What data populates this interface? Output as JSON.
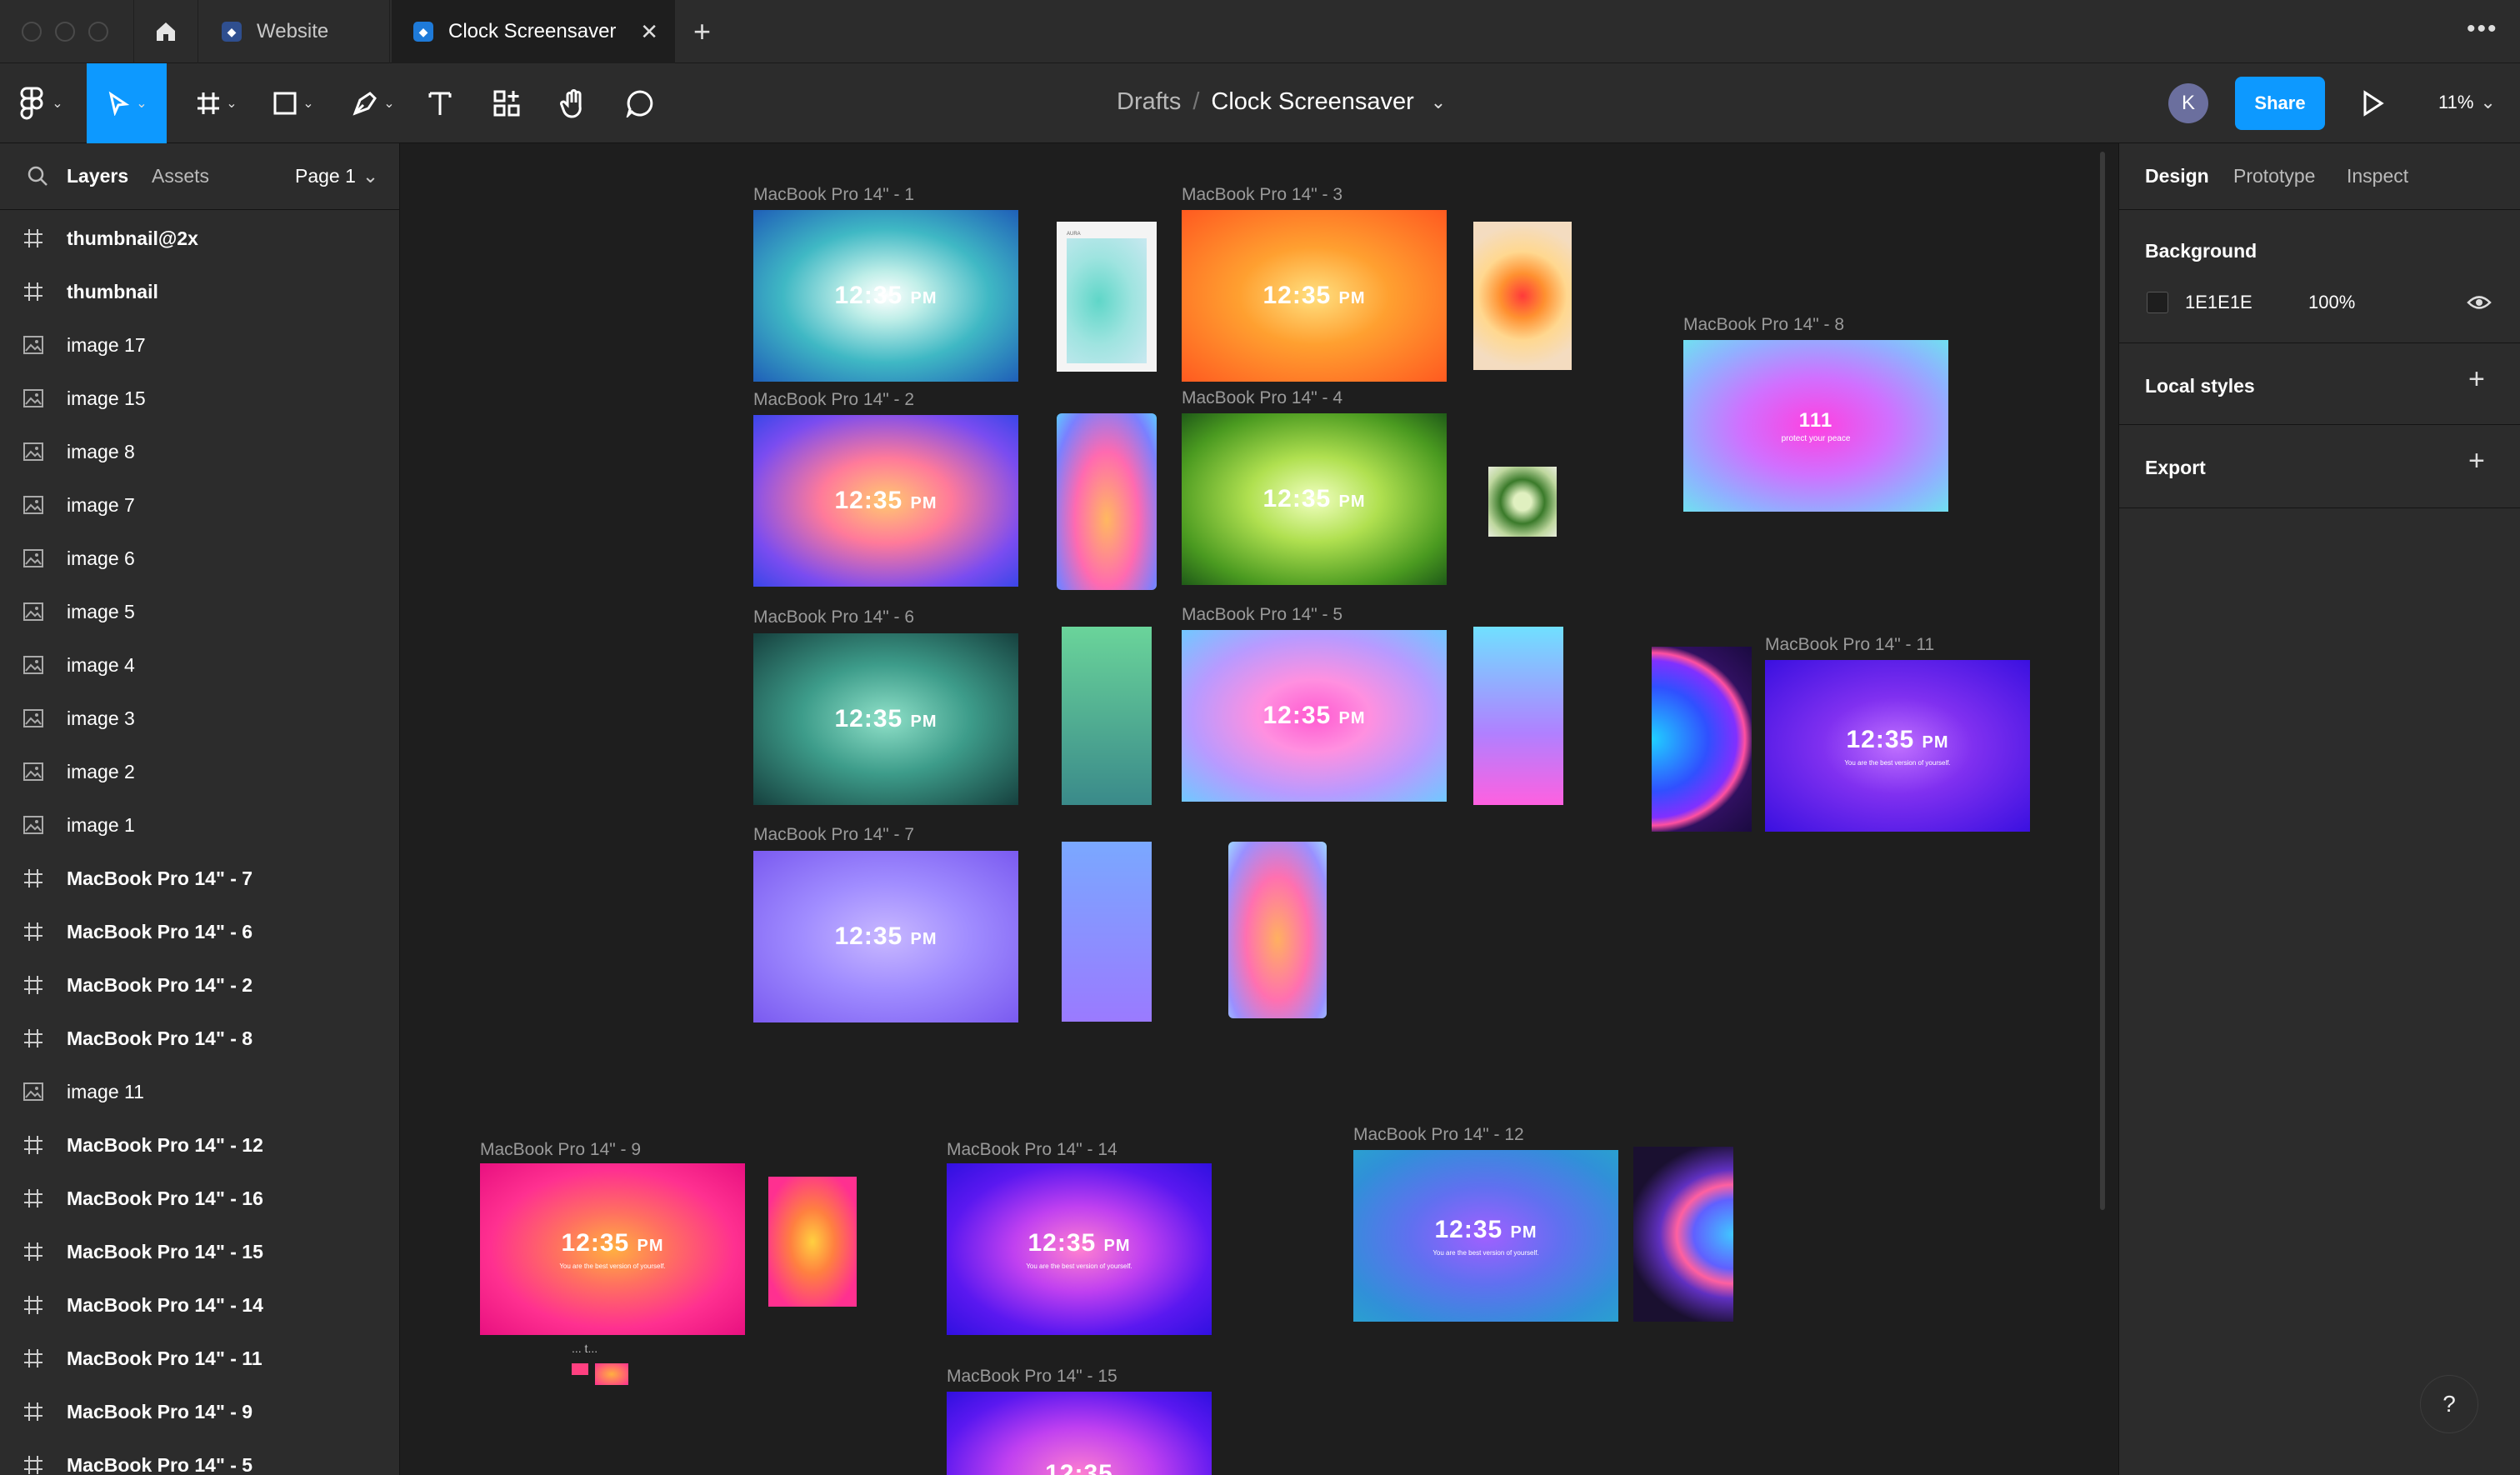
{
  "tabs": {
    "website": "Website",
    "active": "Clock Screensaver"
  },
  "header": {
    "breadcrumb_parent": "Drafts",
    "breadcrumb_sep": "/",
    "file_name": "Clock Screensaver",
    "avatar_initial": "K",
    "share_label": "Share",
    "zoom": "11%"
  },
  "left_panel": {
    "tab_layers": "Layers",
    "tab_assets": "Assets",
    "page": "Page 1",
    "layers": [
      {
        "name": "thumbnail@2x",
        "type": "frame"
      },
      {
        "name": "thumbnail",
        "type": "frame"
      },
      {
        "name": "image 17",
        "type": "image"
      },
      {
        "name": "image 15",
        "type": "image"
      },
      {
        "name": "image 8",
        "type": "image"
      },
      {
        "name": "image 7",
        "type": "image"
      },
      {
        "name": "image 6",
        "type": "image"
      },
      {
        "name": "image 5",
        "type": "image"
      },
      {
        "name": "image 4",
        "type": "image"
      },
      {
        "name": "image 3",
        "type": "image"
      },
      {
        "name": "image 2",
        "type": "image"
      },
      {
        "name": "image 1",
        "type": "image"
      },
      {
        "name": "MacBook Pro 14\" - 7",
        "type": "frame"
      },
      {
        "name": "MacBook Pro 14\" - 6",
        "type": "frame"
      },
      {
        "name": "MacBook Pro 14\" - 2",
        "type": "frame"
      },
      {
        "name": "MacBook Pro 14\" - 8",
        "type": "frame"
      },
      {
        "name": "image 11",
        "type": "image"
      },
      {
        "name": "MacBook Pro 14\" - 12",
        "type": "frame"
      },
      {
        "name": "MacBook Pro 14\" - 16",
        "type": "frame"
      },
      {
        "name": "MacBook Pro 14\" - 15",
        "type": "frame"
      },
      {
        "name": "MacBook Pro 14\" - 14",
        "type": "frame"
      },
      {
        "name": "MacBook Pro 14\" - 11",
        "type": "frame"
      },
      {
        "name": "MacBook Pro 14\" - 9",
        "type": "frame"
      },
      {
        "name": "MacBook Pro 14\" - 5",
        "type": "frame"
      }
    ]
  },
  "right_panel": {
    "tab_design": "Design",
    "tab_prototype": "Prototype",
    "tab_inspect": "Inspect",
    "background_title": "Background",
    "background_hex": "1E1E1E",
    "background_opacity": "100%",
    "local_styles": "Local styles",
    "export": "Export"
  },
  "canvas": {
    "clock_time": "12:35",
    "clock_ampm": "PM",
    "tagline": "You are the best version of yourself.",
    "frame8_number": "111",
    "frame8_text": "protect your peace",
    "poster_title": "AURA",
    "tiny_labels": "...  t...",
    "frames": {
      "f1": "MacBook Pro 14\" - 1",
      "f2": "MacBook Pro 14\" - 2",
      "f3": "MacBook Pro 14\" - 3",
      "f4": "MacBook Pro 14\" - 4",
      "f5": "MacBook Pro 14\" - 5",
      "f6": "MacBook Pro 14\" - 6",
      "f7": "MacBook Pro 14\" - 7",
      "f8": "MacBook Pro 14\" - 8",
      "f9": "MacBook Pro 14\" - 9",
      "f11": "MacBook Pro 14\" - 11",
      "f12": "MacBook Pro 14\" - 12",
      "f14": "MacBook Pro 14\" - 14",
      "f15": "MacBook Pro 14\" - 15"
    }
  },
  "help_label": "?"
}
